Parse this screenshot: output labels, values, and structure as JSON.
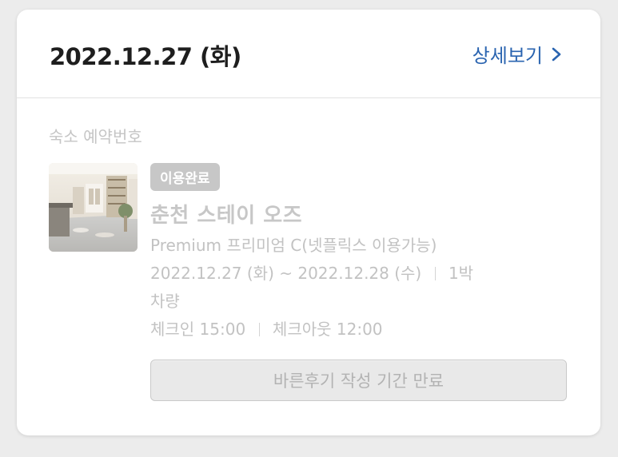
{
  "header": {
    "date": "2022.12.27 (화)",
    "detail_link_label": "상세보기",
    "detail_link_icon": "chevron-right-icon",
    "link_color": "#2a64b0"
  },
  "reservation": {
    "section_label": "숙소 예약번호",
    "status_badge": "이용완료",
    "hotel_name": "춘천 스테이 오즈",
    "room_type": "Premium 프리미엄 C(넷플릭스 이용가능)",
    "stay_start": "2022.12.27 (화)",
    "stay_range_sep": "~",
    "stay_end": "2022.12.28 (수)",
    "nights": "1박",
    "vehicle": "차량",
    "check_in": "체크인 15:00",
    "check_out": "체크아웃 12:00"
  },
  "actions": {
    "review_button_label": "바른후기 작성 기간 만료"
  }
}
